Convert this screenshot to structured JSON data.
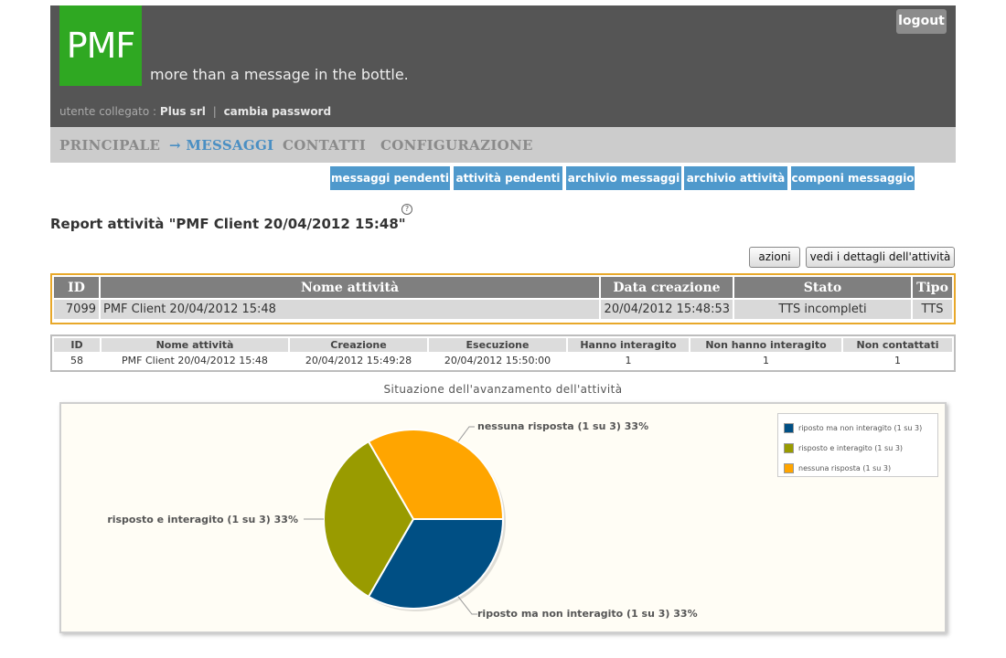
{
  "header": {
    "logo": "PMF",
    "tagline": "more than a message in the bottle.",
    "logout": "logout",
    "user_label": "utente collegato :",
    "user_name": "Plus srl",
    "separator": "|",
    "change_password": "cambia password"
  },
  "nav": {
    "items": [
      "PRINCIPALE",
      "→ MESSAGGI",
      "CONTATTI",
      "CONFIGURAZIONE"
    ],
    "active": "MESSAGGI"
  },
  "subnav": [
    "messaggi pendenti",
    "attività pendenti",
    "archivio messaggi",
    "archivio attività",
    "componi messaggio"
  ],
  "report": {
    "help": "?",
    "title": "Report attività \"PMF Client 20/04/2012 15:48\""
  },
  "actions": {
    "azioni": "azioni",
    "details": "vedi i dettagli dell'attività"
  },
  "main_table": {
    "headers": [
      "ID",
      "Nome attività",
      "Data creazione",
      "Stato",
      "Tipo"
    ],
    "row": [
      "7099",
      "PMF Client 20/04/2012 15:48",
      "20/04/2012 15:48:53",
      "TTS incompleti",
      "TTS"
    ]
  },
  "detail_table": {
    "headers": [
      "ID",
      "Nome attività",
      "Creazione",
      "Esecuzione",
      "Hanno interagito",
      "Non hanno interagito",
      "Non contattati"
    ],
    "row": [
      "58",
      "PMF Client 20/04/2012 15:48",
      "20/04/2012 15:49:28",
      "20/04/2012 15:50:00",
      "1",
      "1",
      "1"
    ]
  },
  "chart_data": {
    "type": "pie",
    "title": "Situazione dell'avanzamento dell'attività",
    "slices": [
      {
        "label": "riposto ma non interagito (1 su 3) 33%",
        "legend": "riposto ma non interagito (1 su 3)",
        "value": 1,
        "color": "#004f84"
      },
      {
        "label": "risposto e interagito (1 su 3) 33%",
        "legend": "risposto e interagito (1 su 3)",
        "value": 1,
        "color": "#999b00"
      },
      {
        "label": "nessuna risposta (1 su 3) 33%",
        "legend": "nessuna risposta (1 su 3)",
        "value": 1,
        "color": "#ffa500"
      }
    ],
    "legend_position": "top-right"
  },
  "colors": {
    "header_bg": "#555555",
    "logo_bg": "#2fa822",
    "subnav_bg": "#4f99cc",
    "nav_active": "#4a8fc3",
    "table_border": "#e8a82a"
  }
}
